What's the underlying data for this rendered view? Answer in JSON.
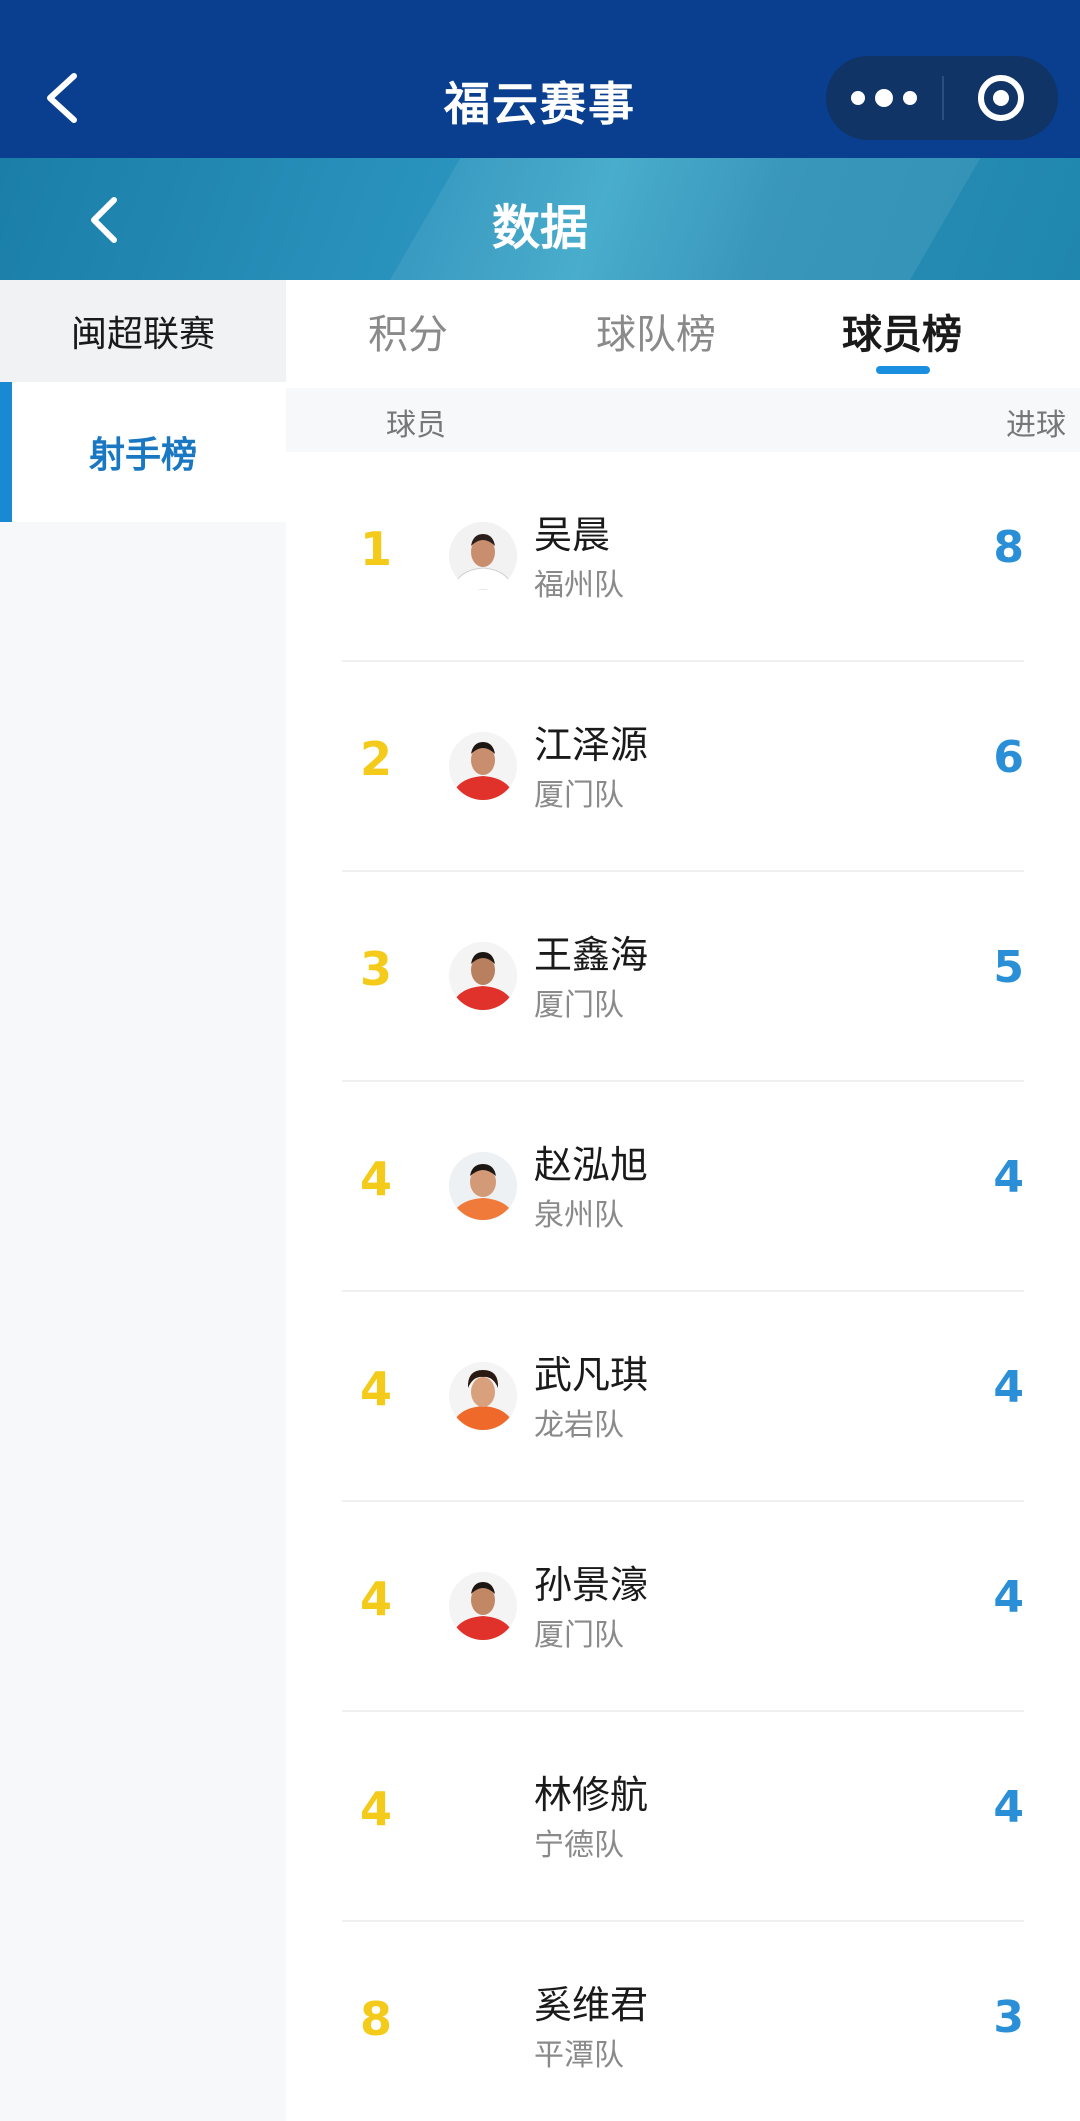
{
  "topbar": {
    "title": "福云赛事"
  },
  "header": {
    "title": "数据"
  },
  "sidebar": {
    "items": [
      {
        "label": "闽超联赛"
      },
      {
        "label": "射手榜"
      }
    ]
  },
  "tabs": [
    {
      "label": "积分"
    },
    {
      "label": "球队榜"
    },
    {
      "label": "球员榜"
    }
  ],
  "table": {
    "columns": {
      "player": "球员",
      "goals": "进球"
    },
    "rows": [
      {
        "rank": "1",
        "name": "吴晨",
        "team": "福州队",
        "goals": "8",
        "avatar": "white-kit"
      },
      {
        "rank": "2",
        "name": "江泽源",
        "team": "厦门队",
        "goals": "6",
        "avatar": "red-kit"
      },
      {
        "rank": "3",
        "name": "王鑫海",
        "team": "厦门队",
        "goals": "5",
        "avatar": "red-kit"
      },
      {
        "rank": "4",
        "name": "赵泓旭",
        "team": "泉州队",
        "goals": "4",
        "avatar": "orange-kit"
      },
      {
        "rank": "4",
        "name": "武凡琪",
        "team": "龙岩队",
        "goals": "4",
        "avatar": "orange-kit"
      },
      {
        "rank": "4",
        "name": "孙景濠",
        "team": "厦门队",
        "goals": "4",
        "avatar": "red-kit"
      },
      {
        "rank": "4",
        "name": "林修航",
        "team": "宁德队",
        "goals": "4",
        "avatar": "none"
      },
      {
        "rank": "8",
        "name": "奚维君",
        "team": "平潭队",
        "goals": "3",
        "avatar": "none"
      }
    ]
  },
  "colors": {
    "brand": "#0a3e8e",
    "accent": "#1a89d4",
    "rank": "#f4cb1a",
    "goals": "#2a8fd6"
  }
}
